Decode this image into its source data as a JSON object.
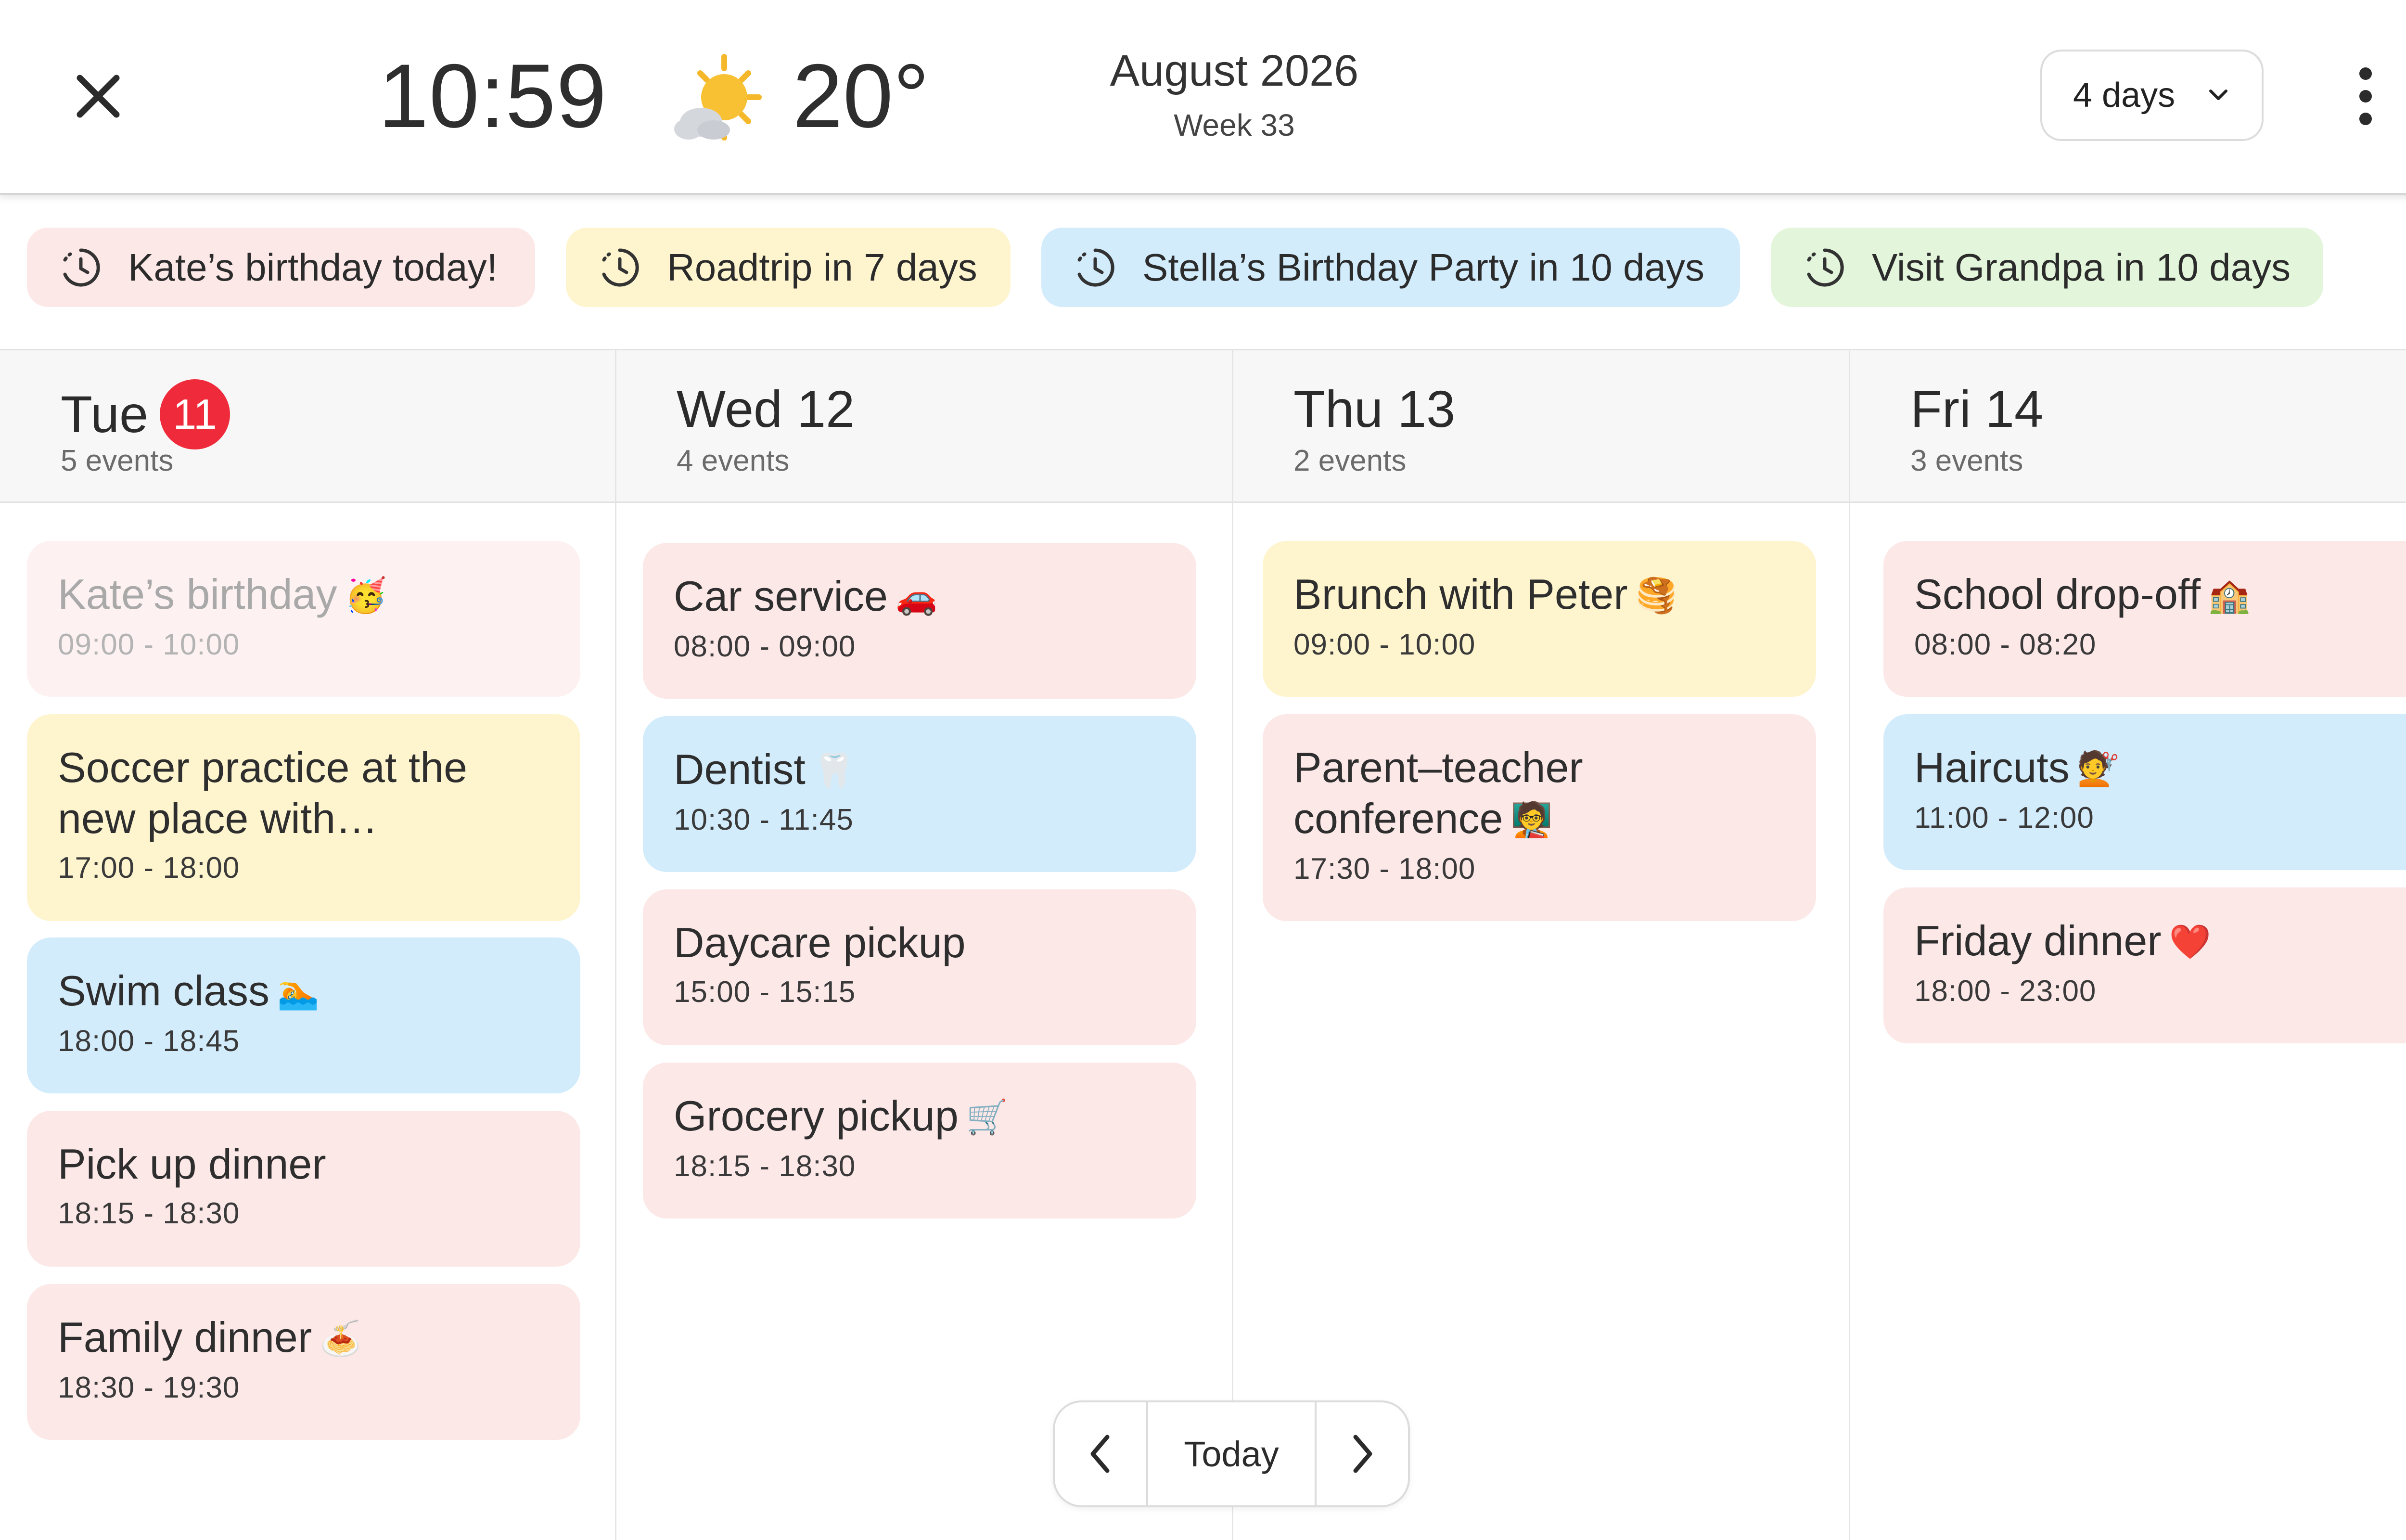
{
  "header": {
    "time": "10:59",
    "weather_icon": "sun-behind-cloud-icon",
    "temperature": "20°",
    "month": "August 2026",
    "week": "Week 33",
    "range_select": "4 days"
  },
  "countdowns": [
    {
      "label": "Kate’s birthday today!",
      "color": "#fde8e8"
    },
    {
      "label": "Roadtrip in 7 days",
      "color": "#fef5cf"
    },
    {
      "label": "Stella’s Birthday Party in 10 days",
      "color": "#d2ecfc"
    },
    {
      "label": "Visit Grandpa in 10 days",
      "color": "#e3f6dc"
    }
  ],
  "days": [
    {
      "name": "Tue",
      "date": "11",
      "is_today": true,
      "count": "5 events",
      "events": [
        {
          "title": "Kate’s birthday",
          "emoji": "🥳",
          "time": "09:00 - 10:00",
          "color": "faded"
        },
        {
          "title": "Soccer practice at the",
          "title2": "new place with…",
          "time": "17:00 - 18:00",
          "color": "yellow"
        },
        {
          "title": "Swim class",
          "emoji": "🏊",
          "time": "18:00 - 18:45",
          "color": "blue"
        },
        {
          "title": "Pick up dinner",
          "time": "18:15 - 18:30",
          "color": "red"
        },
        {
          "title": "Family dinner",
          "emoji": "🍝",
          "time": "18:30 - 19:30",
          "color": "red"
        }
      ]
    },
    {
      "name": "Wed 12",
      "count": "4 events",
      "events": [
        {
          "title": "Car service",
          "emoji": "🚗",
          "time": "08:00 - 09:00",
          "color": "red"
        },
        {
          "title": "Dentist",
          "emoji": "🦷",
          "time": "10:30 - 11:45",
          "color": "blue"
        },
        {
          "title": "Daycare pickup",
          "time": "15:00 - 15:15",
          "color": "red"
        },
        {
          "title": "Grocery pickup",
          "emoji": "🛒",
          "time": "18:15 - 18:30",
          "color": "red"
        }
      ]
    },
    {
      "name": "Thu 13",
      "count": "2 events",
      "events": [
        {
          "title": "Brunch with Peter",
          "emoji": "🥞",
          "time": "09:00 - 10:00",
          "color": "yellow"
        },
        {
          "title": "Parent–teacher",
          "title2": "conference",
          "emoji": "🧑‍🏫",
          "time": "17:30 - 18:00",
          "color": "red"
        }
      ]
    },
    {
      "name": "Fri 14",
      "count": "3 events",
      "events": [
        {
          "title": "School drop-off",
          "emoji": "🏫",
          "time": "08:00 - 08:20",
          "color": "red"
        },
        {
          "title": "Haircuts",
          "emoji": "💇",
          "time": "11:00 - 12:00",
          "color": "blue"
        },
        {
          "title": "Friday dinner",
          "emoji": "❤️",
          "time": "18:00 - 23:00",
          "color": "red"
        }
      ]
    }
  ],
  "nav": {
    "today_label": "Today"
  }
}
